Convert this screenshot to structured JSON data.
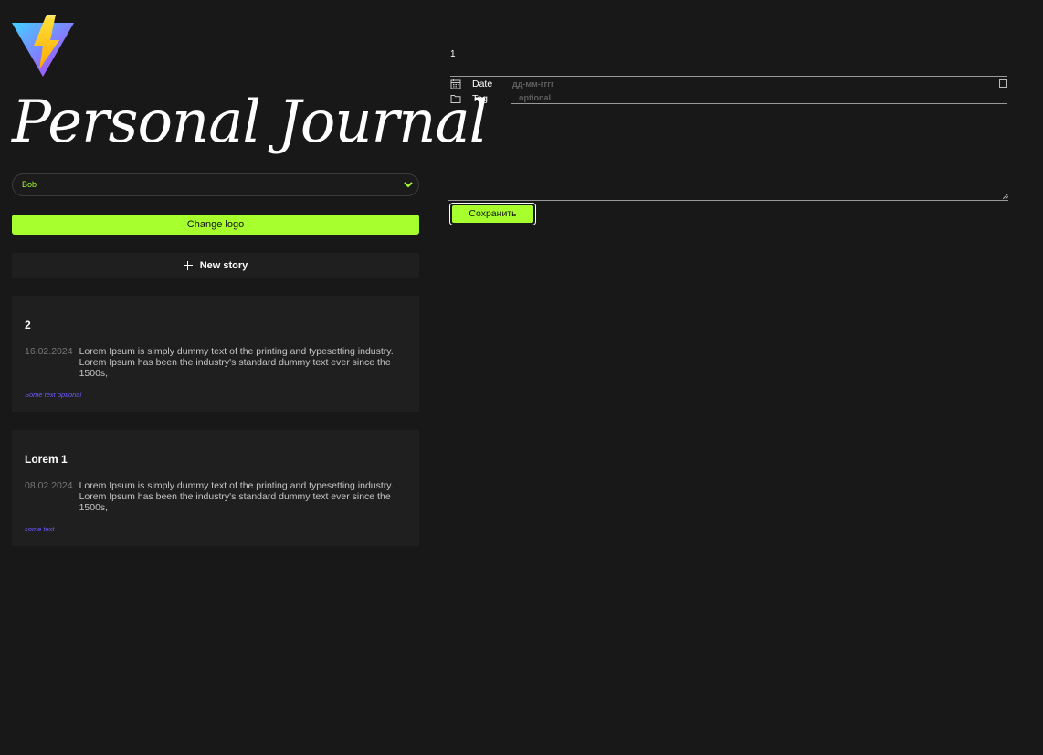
{
  "header": {
    "title": "Personal Journal"
  },
  "user_select": {
    "selected": "Bob"
  },
  "buttons": {
    "change_logo": "Change logo",
    "new_story": "New story",
    "save": "Сохранить"
  },
  "posts": [
    {
      "title": "2",
      "date": "16.02.2024",
      "text": "Lorem Ipsum is simply dummy text of the printing and typesetting industry. Lorem Ipsum has been the industry's standard dummy text ever since the 1500s,",
      "tag": "Some text optional"
    },
    {
      "title": "Lorem 1",
      "date": "08.02.2024",
      "text": "Lorem Ipsum is simply dummy text of the printing and typesetting industry. Lorem Ipsum has been the industry's standard dummy text ever since the 1500s,",
      "tag": "some text"
    }
  ],
  "form": {
    "title_value": "1",
    "date_label": "Date",
    "date_placeholder": "дд-мм-гггг",
    "tag_label": "Tag",
    "tag_placeholder": "optional"
  },
  "icons": {
    "logo": "vite-logo-icon",
    "calendar": "calendar-icon",
    "folder": "folder-icon",
    "plus": "plus-icon",
    "chevron": "chevron-down-icon"
  },
  "colors": {
    "accent": "#a8ff2e",
    "background": "#181818",
    "card": "#1f1f1f",
    "tag": "#6a5cff"
  }
}
